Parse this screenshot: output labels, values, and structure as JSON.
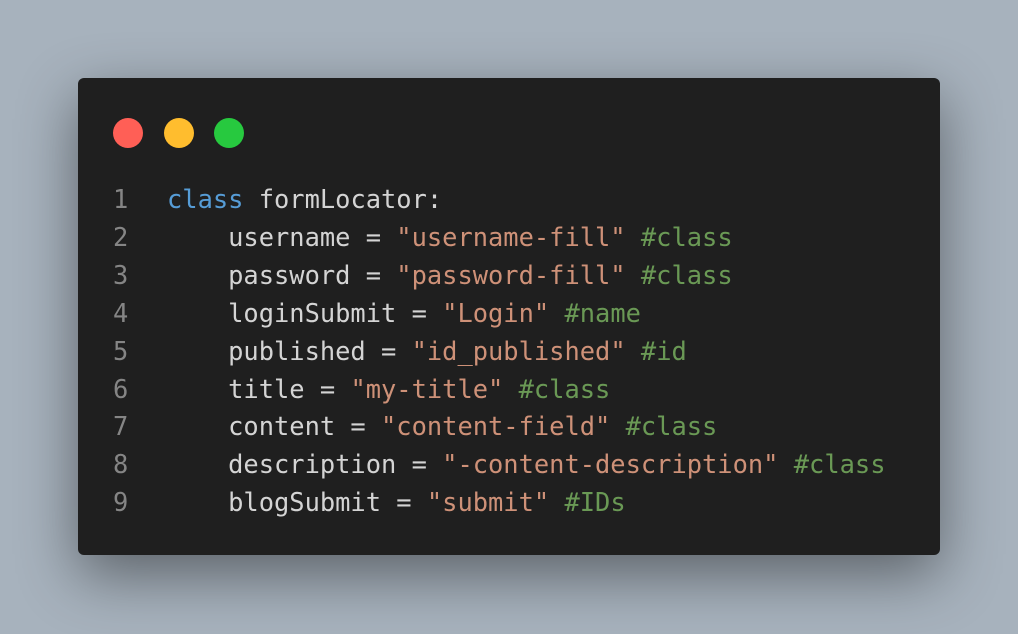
{
  "window": {
    "controls": [
      {
        "name": "close",
        "color": "#ff5f56"
      },
      {
        "name": "minimize",
        "color": "#ffbd2e"
      },
      {
        "name": "maximize",
        "color": "#27c93f"
      }
    ]
  },
  "code": {
    "language": "python",
    "lines": [
      {
        "number": "1",
        "tokens": [
          {
            "t": "kw",
            "v": "class"
          },
          {
            "t": "plain",
            "v": " formLocator:"
          }
        ]
      },
      {
        "number": "2",
        "tokens": [
          {
            "t": "plain",
            "v": "    username = "
          },
          {
            "t": "str",
            "v": "\"username-fill\""
          },
          {
            "t": "plain",
            "v": " "
          },
          {
            "t": "cm",
            "v": "#class"
          }
        ]
      },
      {
        "number": "3",
        "tokens": [
          {
            "t": "plain",
            "v": "    password = "
          },
          {
            "t": "str",
            "v": "\"password-fill\""
          },
          {
            "t": "plain",
            "v": " "
          },
          {
            "t": "cm",
            "v": "#class"
          }
        ]
      },
      {
        "number": "4",
        "tokens": [
          {
            "t": "plain",
            "v": "    loginSubmit = "
          },
          {
            "t": "str",
            "v": "\"Login\""
          },
          {
            "t": "plain",
            "v": " "
          },
          {
            "t": "cm",
            "v": "#name"
          }
        ]
      },
      {
        "number": "5",
        "tokens": [
          {
            "t": "plain",
            "v": "    published = "
          },
          {
            "t": "str",
            "v": "\"id_published\""
          },
          {
            "t": "plain",
            "v": " "
          },
          {
            "t": "cm",
            "v": "#id"
          }
        ]
      },
      {
        "number": "6",
        "tokens": [
          {
            "t": "plain",
            "v": "    title = "
          },
          {
            "t": "str",
            "v": "\"my-title\""
          },
          {
            "t": "plain",
            "v": " "
          },
          {
            "t": "cm",
            "v": "#class"
          }
        ]
      },
      {
        "number": "7",
        "tokens": [
          {
            "t": "plain",
            "v": "    content = "
          },
          {
            "t": "str",
            "v": "\"content-field\""
          },
          {
            "t": "plain",
            "v": " "
          },
          {
            "t": "cm",
            "v": "#class"
          }
        ]
      },
      {
        "number": "8",
        "tokens": [
          {
            "t": "plain",
            "v": "    description = "
          },
          {
            "t": "str",
            "v": "\"-content-description\""
          },
          {
            "t": "plain",
            "v": " "
          },
          {
            "t": "cm",
            "v": "#class"
          }
        ]
      },
      {
        "number": "9",
        "tokens": [
          {
            "t": "plain",
            "v": "    blogSubmit = "
          },
          {
            "t": "str",
            "v": "\"submit\""
          },
          {
            "t": "plain",
            "v": " "
          },
          {
            "t": "cm",
            "v": "#IDs"
          }
        ]
      }
    ]
  }
}
